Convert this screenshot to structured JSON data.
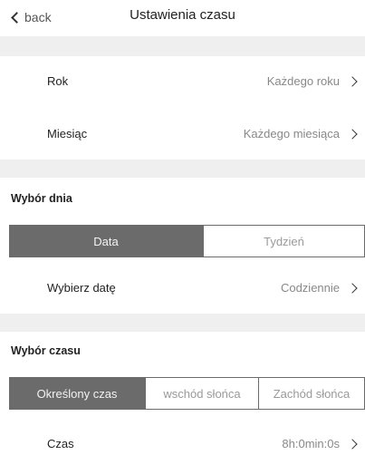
{
  "header": {
    "back_label": "back",
    "title": "Ustawienia czasu"
  },
  "rows": {
    "year": {
      "label": "Rok",
      "value": "Każdego roku"
    },
    "month": {
      "label": "Miesiąc",
      "value": "Każdego miesiąca"
    },
    "pick_date": {
      "label": "Wybierz datę",
      "value": "Codziennie"
    },
    "time": {
      "label": "Czas",
      "value": "8h:0min:0s"
    }
  },
  "day_selection": {
    "title": "Wybór dnia",
    "segments": [
      "Data",
      "Tydzień"
    ],
    "selected": "Data"
  },
  "time_selection": {
    "title": "Wybór czasu",
    "segments": [
      "Określony czas",
      "wschód słońca",
      "Zachód słońca"
    ],
    "selected": "Określony czas"
  },
  "colors": {
    "active_segment": "#6b6b6b",
    "gap": "#efefef"
  }
}
